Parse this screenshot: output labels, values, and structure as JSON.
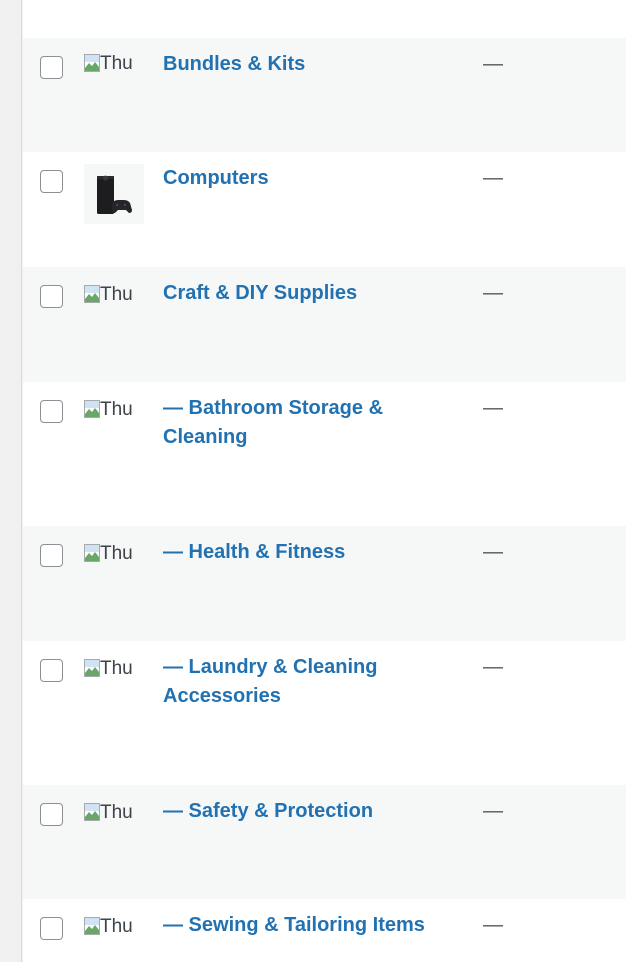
{
  "rows": [
    {
      "name": "Bundles & Kits",
      "thumb_alt": "Thu",
      "thumb_type": "broken",
      "description": "—"
    },
    {
      "name": "Computers",
      "thumb_alt": "",
      "thumb_type": "console-image",
      "description": "—"
    },
    {
      "name": "Craft & DIY Supplies",
      "thumb_alt": "Thu",
      "thumb_type": "broken",
      "description": "—"
    },
    {
      "name": "— Bathroom Storage & Cleaning",
      "thumb_alt": "Thu",
      "thumb_type": "broken",
      "description": "—"
    },
    {
      "name": "— Health & Fitness",
      "thumb_alt": "Thu",
      "thumb_type": "broken",
      "description": "—"
    },
    {
      "name": "— Laundry & Cleaning Accessories",
      "thumb_alt": "Thu",
      "thumb_type": "broken",
      "description": "—"
    },
    {
      "name": "— Safety & Protection",
      "thumb_alt": "Thu",
      "thumb_type": "broken",
      "description": "—"
    },
    {
      "name": "— Sewing & Tailoring Items",
      "thumb_alt": "Thu",
      "thumb_type": "broken",
      "description": "—"
    }
  ],
  "colors": {
    "link": "#2271b1",
    "row_alt": "#f6f7f7",
    "row_plain": "#ffffff"
  }
}
